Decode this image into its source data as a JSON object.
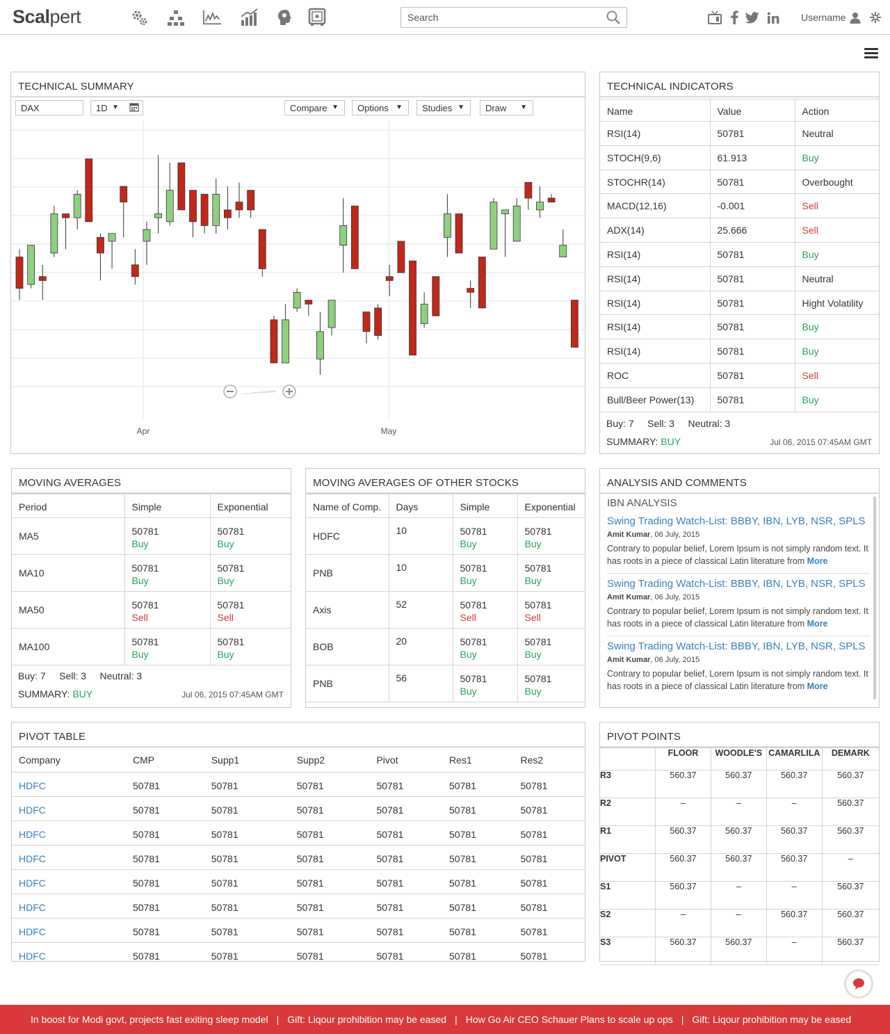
{
  "app": {
    "logo_bold": "Scal",
    "logo_rest": "pert"
  },
  "header": {
    "search_placeholder": "Search",
    "username": "Username"
  },
  "tech_summary": {
    "title": "TECHNICAL SUMMARY",
    "symbol": "DAX",
    "interval": "1D",
    "compare": "Compare",
    "options": "Options",
    "studies": "Studies",
    "draw": "Draw",
    "x_labels": [
      "Apr",
      "May"
    ]
  },
  "chart_data": {
    "type": "candlestick",
    "x_ticks": [
      "Apr",
      "May"
    ],
    "up_color": "#8fcf7f",
    "down_color": "#c0281a",
    "candles": [
      {
        "o": 60,
        "c": 68,
        "h": 70,
        "l": 57,
        "dir": "down"
      },
      {
        "o": 61,
        "c": 71,
        "h": 71,
        "l": 60,
        "dir": "up"
      },
      {
        "o": 63,
        "c": 62,
        "h": 66,
        "l": 57,
        "dir": "down"
      },
      {
        "o": 69,
        "c": 79,
        "h": 81,
        "l": 68,
        "dir": "up"
      },
      {
        "o": 79,
        "c": 78,
        "h": 78,
        "l": 70,
        "dir": "down"
      },
      {
        "o": 78,
        "c": 84,
        "h": 85,
        "l": 75,
        "dir": "up"
      },
      {
        "o": 93,
        "c": 77,
        "h": 93,
        "l": 77,
        "dir": "down"
      },
      {
        "o": 73,
        "c": 69,
        "h": 74,
        "l": 62,
        "dir": "down"
      },
      {
        "o": 72,
        "c": 74,
        "h": 74,
        "l": 65,
        "dir": "up"
      },
      {
        "o": 86,
        "c": 82,
        "h": 86,
        "l": 73,
        "dir": "down"
      },
      {
        "o": 66,
        "c": 63,
        "h": 70,
        "l": 61,
        "dir": "down"
      },
      {
        "o": 72,
        "c": 75,
        "h": 77,
        "l": 66,
        "dir": "up"
      },
      {
        "o": 78,
        "c": 79,
        "h": 94,
        "l": 74,
        "dir": "up"
      },
      {
        "o": 85,
        "c": 77,
        "h": 92,
        "l": 76,
        "dir": "up"
      },
      {
        "o": 92,
        "c": 80,
        "h": 92,
        "l": 80,
        "dir": "down"
      },
      {
        "o": 85,
        "c": 77,
        "h": 85,
        "l": 73,
        "dir": "down"
      },
      {
        "o": 84,
        "c": 76,
        "h": 84,
        "l": 74,
        "dir": "down"
      },
      {
        "o": 76,
        "c": 84,
        "h": 88,
        "l": 74,
        "dir": "up"
      },
      {
        "o": 80,
        "c": 78,
        "h": 86,
        "l": 75,
        "dir": "down"
      },
      {
        "o": 82,
        "c": 80,
        "h": 87,
        "l": 78,
        "dir": "down"
      },
      {
        "o": 85,
        "c": 80,
        "h": 85,
        "l": 78,
        "dir": "down"
      },
      {
        "o": 75,
        "c": 65,
        "h": 75,
        "l": 63,
        "dir": "down"
      },
      {
        "o": 52,
        "c": 41,
        "h": 53,
        "l": 41,
        "dir": "down"
      },
      {
        "o": 41,
        "c": 52,
        "h": 56,
        "l": 41,
        "dir": "up"
      },
      {
        "o": 55,
        "c": 59,
        "h": 60,
        "l": 54,
        "dir": "up"
      },
      {
        "o": 57,
        "c": 56,
        "h": 57,
        "l": 53,
        "dir": "down"
      },
      {
        "o": 42,
        "c": 49,
        "h": 54,
        "l": 38,
        "dir": "up"
      },
      {
        "o": 50,
        "c": 57,
        "h": 57,
        "l": 48,
        "dir": "up"
      },
      {
        "o": 76,
        "c": 71,
        "h": 83,
        "l": 64,
        "dir": "up"
      },
      {
        "o": 81,
        "c": 65,
        "h": 81,
        "l": 65,
        "dir": "down"
      },
      {
        "o": 54,
        "c": 49,
        "h": 54,
        "l": 46,
        "dir": "down"
      },
      {
        "o": 55,
        "c": 48,
        "h": 56,
        "l": 47,
        "dir": "down"
      },
      {
        "o": 63,
        "c": 62,
        "h": 66,
        "l": 58,
        "dir": "down"
      },
      {
        "o": 72,
        "c": 64,
        "h": 72,
        "l": 64,
        "dir": "down"
      },
      {
        "o": 67,
        "c": 43,
        "h": 67,
        "l": 43,
        "dir": "down"
      },
      {
        "o": 51,
        "c": 56,
        "h": 59,
        "l": 50,
        "dir": "up"
      },
      {
        "o": 63,
        "c": 53,
        "h": 63,
        "l": 53,
        "dir": "down"
      },
      {
        "o": 73,
        "c": 79,
        "h": 84,
        "l": 68,
        "dir": "up"
      },
      {
        "o": 79,
        "c": 69,
        "h": 79,
        "l": 69,
        "dir": "down"
      },
      {
        "o": 60,
        "c": 59,
        "h": 62,
        "l": 55,
        "dir": "down"
      },
      {
        "o": 68,
        "c": 55,
        "h": 68,
        "l": 55,
        "dir": "down"
      },
      {
        "o": 70,
        "c": 82,
        "h": 83,
        "l": 70,
        "dir": "up"
      },
      {
        "o": 79,
        "c": 80,
        "h": 80,
        "l": 68,
        "dir": "up"
      },
      {
        "o": 72,
        "c": 81,
        "h": 83,
        "l": 72,
        "dir": "up"
      },
      {
        "o": 87,
        "c": 83,
        "h": 87,
        "l": 80,
        "dir": "down"
      },
      {
        "o": 80,
        "c": 82,
        "h": 86,
        "l": 78,
        "dir": "up"
      },
      {
        "o": 83,
        "c": 82,
        "h": 84,
        "l": 82,
        "dir": "down"
      },
      {
        "o": 68,
        "c": 71,
        "h": 75,
        "l": 68,
        "dir": "up"
      },
      {
        "o": 57,
        "c": 45,
        "h": 57,
        "l": 45,
        "dir": "down"
      }
    ]
  },
  "tech_indicators": {
    "title": "TECHNICAL INDICATORS",
    "headers": [
      "Name",
      "Value",
      "Action"
    ],
    "rows": [
      {
        "name": "RSI(14)",
        "value": "50781",
        "action": "Neutral",
        "kind": "neutral"
      },
      {
        "name": "STOCH(9,6)",
        "value": "61.913",
        "action": "Buy",
        "kind": "buy"
      },
      {
        "name": "STOCHR(14)",
        "value": "50781",
        "action": "Overbought",
        "kind": "neutral"
      },
      {
        "name": "MACD(12,16)",
        "value": "-0.001",
        "action": "Sell",
        "kind": "sell"
      },
      {
        "name": "ADX(14)",
        "value": "25.666",
        "action": "Sell",
        "kind": "sell"
      },
      {
        "name": "RSI(14)",
        "value": "50781",
        "action": "Buy",
        "kind": "buy"
      },
      {
        "name": "RSI(14)",
        "value": "50781",
        "action": "Neutral",
        "kind": "neutral"
      },
      {
        "name": "RSI(14)",
        "value": "50781",
        "action": "Hight Volatility",
        "kind": "neutral"
      },
      {
        "name": "RSI(14)",
        "value": "50781",
        "action": "Buy",
        "kind": "buy"
      },
      {
        "name": "RSI(14)",
        "value": "50781",
        "action": "Buy",
        "kind": "buy"
      },
      {
        "name": "ROC",
        "value": "50781",
        "action": "Sell",
        "kind": "sell"
      },
      {
        "name": "Bull/Beer Power(13)",
        "value": "50781",
        "action": "Buy",
        "kind": "buy"
      }
    ],
    "counts": "Buy: 7     Sell: 3     Neutral: 3",
    "summary_label": "SUMMARY:",
    "summary_value": "BUY",
    "timestamp": "Jul 06, 2015 07:45AM GMT"
  },
  "moving_averages": {
    "title": "MOVING AVERAGES",
    "headers": [
      "Period",
      "Simple",
      "Exponential"
    ],
    "rows": [
      {
        "period": "MA5",
        "simple": "50781",
        "simple_action": "Buy",
        "simple_kind": "buy",
        "exp": "50781",
        "exp_action": "Buy",
        "exp_kind": "buy"
      },
      {
        "period": "MA10",
        "simple": "50781",
        "simple_action": "Buy",
        "simple_kind": "buy",
        "exp": "50781",
        "exp_action": "Buy",
        "exp_kind": "buy"
      },
      {
        "period": "MA50",
        "simple": "50781",
        "simple_action": "Sell",
        "simple_kind": "sell",
        "exp": "50781",
        "exp_action": "Sell",
        "exp_kind": "sell"
      },
      {
        "period": "MA100",
        "simple": "50781",
        "simple_action": "Buy",
        "simple_kind": "buy",
        "exp": "50781",
        "exp_action": "Buy",
        "exp_kind": "buy"
      }
    ],
    "counts": "Buy: 7     Sell: 3     Neutral: 3",
    "summary_label": "SUMMARY:",
    "summary_value": "BUY",
    "timestamp": "Jul 06, 2015 07:45AM GMT"
  },
  "ma_other": {
    "title": "MOVING AVERAGES OF OTHER STOCKS",
    "headers": [
      "Name of Comp.",
      "Days",
      "Simple",
      "Exponential"
    ],
    "rows": [
      {
        "name": "HDFC",
        "days": "10",
        "simple": "50781",
        "simple_action": "Buy",
        "simple_kind": "buy",
        "exp": "50781",
        "exp_action": "Buy",
        "exp_kind": "buy"
      },
      {
        "name": "PNB",
        "days": "10",
        "simple": "50781",
        "simple_action": "Buy",
        "simple_kind": "buy",
        "exp": "50781",
        "exp_action": "Buy",
        "exp_kind": "buy"
      },
      {
        "name": "Axis",
        "days": "52",
        "simple": "50781",
        "simple_action": "Sell",
        "simple_kind": "sell",
        "exp": "50781",
        "exp_action": "Sell",
        "exp_kind": "sell"
      },
      {
        "name": "BOB",
        "days": "20",
        "simple": "50781",
        "simple_action": "Buy",
        "simple_kind": "buy",
        "exp": "50781",
        "exp_action": "Buy",
        "exp_kind": "buy"
      },
      {
        "name": "PNB",
        "days": "56",
        "simple": "50781",
        "simple_action": "Buy",
        "simple_kind": "buy",
        "exp": "50781",
        "exp_action": "Buy",
        "exp_kind": "buy"
      }
    ]
  },
  "analysis": {
    "title": "ANALYSIS AND COMMENTS",
    "subtitle": "IBN ANALYSIS",
    "articles": [
      {
        "title": "Swing Trading Watch-List: BBBY, IBN, LYB, NSR, SPLS",
        "author": "Amit Kumar",
        "date": ", 06 July, 2015",
        "body": "Contrary to popular belief, Lorem Ipsum is not simply random text. It has roots in a piece of classical Latin literature from",
        "more": "More"
      },
      {
        "title": "Swing Trading Watch-List: BBBY, IBN, LYB, NSR, SPLS",
        "author": "Amit Kumar",
        "date": ", 06 July, 2015",
        "body": "Contrary to popular belief, Lorem Ipsum is not simply random text. It has roots in a piece of classical Latin literature from",
        "more": "More"
      },
      {
        "title": "Swing Trading Watch-List: BBBY, IBN, LYB, NSR, SPLS",
        "author": "Amit Kumar",
        "date": ", 06 July, 2015",
        "body": "Contrary to popular belief, Lorem Ipsum is not simply random text. It has roots in a piece of classical Latin literature from",
        "more": "More"
      }
    ]
  },
  "pivot_table": {
    "title": "PIVOT TABLE",
    "headers": [
      "Company",
      "CMP",
      "Supp1",
      "Supp2",
      "Pivot",
      "Res1",
      "Res2"
    ],
    "rows": [
      [
        "HDFC",
        "50781",
        "50781",
        "50781",
        "50781",
        "50781",
        "50781"
      ],
      [
        "HDFC",
        "50781",
        "50781",
        "50781",
        "50781",
        "50781",
        "50781"
      ],
      [
        "HDFC",
        "50781",
        "50781",
        "50781",
        "50781",
        "50781",
        "50781"
      ],
      [
        "HDFC",
        "50781",
        "50781",
        "50781",
        "50781",
        "50781",
        "50781"
      ],
      [
        "HDFC",
        "50781",
        "50781",
        "50781",
        "50781",
        "50781",
        "50781"
      ],
      [
        "HDFC",
        "50781",
        "50781",
        "50781",
        "50781",
        "50781",
        "50781"
      ],
      [
        "HDFC",
        "50781",
        "50781",
        "50781",
        "50781",
        "50781",
        "50781"
      ],
      [
        "HDFC",
        "50781",
        "50781",
        "50781",
        "50781",
        "50781",
        "50781"
      ]
    ]
  },
  "pivot_points": {
    "title": "PIVOT POINTS",
    "headers": [
      "",
      "FLOOR",
      "WOODLE'S",
      "CAMARLILA",
      "DEMARK"
    ],
    "rows": [
      [
        "R3",
        "560.37",
        "560.37",
        "560.37",
        "560.37"
      ],
      [
        "R2",
        "–",
        "–",
        "–",
        "560.37"
      ],
      [
        "R1",
        "560.37",
        "560.37",
        "560.37",
        "560.37"
      ],
      [
        "PIVOT",
        "560.37",
        "560.37",
        "560.37",
        "–"
      ],
      [
        "S1",
        "560.37",
        "–",
        "–",
        "560.37"
      ],
      [
        "S2",
        "–",
        "–",
        "560.37",
        "560.37"
      ],
      [
        "S3",
        "560.37",
        "560.37",
        "–",
        "560.37"
      ]
    ]
  },
  "ticker": {
    "items": [
      "In boost for Modi govt, projects fast exiting sleep model",
      "Gift: Liqour prohibition may be eased",
      "How Go Air CEO Schauer Plans to scale up ops",
      "Gift: Liqour prohibition may be eased"
    ],
    "separator": "|"
  },
  "colors": {
    "buy": "#22a35a",
    "sell": "#d23a2e",
    "link": "#3a80c0",
    "ticker_bg": "#d9393a"
  }
}
